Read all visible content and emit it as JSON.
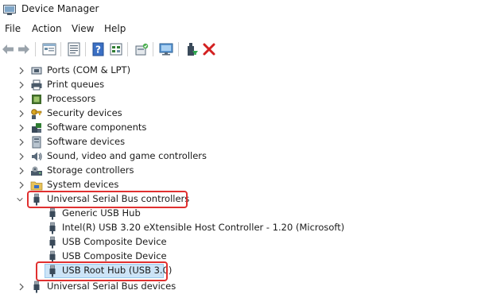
{
  "window": {
    "title": "Device Manager"
  },
  "menu": [
    "File",
    "Action",
    "View",
    "Help"
  ],
  "toolbar_icons": [
    "back-arrow-icon",
    "forward-arrow-icon",
    "properties-sheet-icon",
    "list-view-icon",
    "help-icon",
    "show-hidden-icon",
    "scan-hardware-icon",
    "monitor-icon",
    "update-driver-icon",
    "uninstall-x-icon"
  ],
  "tree": {
    "categories_top": [
      {
        "label": "Ports (COM & LPT)",
        "icon": "port-icon"
      },
      {
        "label": "Print queues",
        "icon": "printer-icon"
      },
      {
        "label": "Processors",
        "icon": "processor-icon"
      },
      {
        "label": "Security devices",
        "icon": "key-icon"
      },
      {
        "label": "Software components",
        "icon": "puzzle-icon"
      },
      {
        "label": "Software devices",
        "icon": "software-device-icon"
      },
      {
        "label": "Sound, video and game controllers",
        "icon": "speaker-icon"
      },
      {
        "label": "Storage controllers",
        "icon": "storage-icon"
      },
      {
        "label": "System devices",
        "icon": "system-folder-icon"
      }
    ],
    "usb_category": {
      "label": "Universal Serial Bus controllers",
      "icon": "usb-icon"
    },
    "usb_children": [
      "Generic USB Hub",
      "Intel(R) USB 3.20 eXtensible Host Controller - 1.20 (Microsoft)",
      "USB Composite Device",
      "USB Composite Device",
      "USB Root Hub (USB 3.0)"
    ],
    "last_category": {
      "label": "Universal Serial Bus devices",
      "icon": "usb-icon"
    }
  },
  "colors": {
    "highlight": "#e03030",
    "selection": "#cce4f7"
  }
}
